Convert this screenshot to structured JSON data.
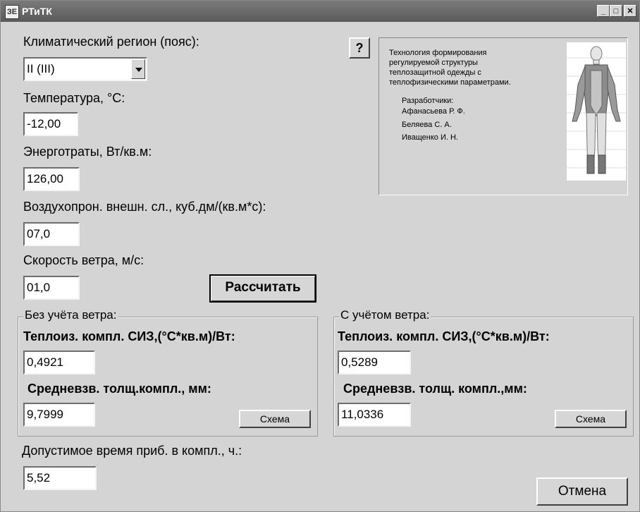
{
  "window": {
    "title": "РТиТК",
    "icon_text": "ЗЕ"
  },
  "titlebar_buttons": {
    "minimize": "_",
    "maximize": "□",
    "close": "✕"
  },
  "form": {
    "region_label": "Климатический регион (пояс):",
    "region_value": "II (III)",
    "help_label": "?",
    "temp_label": "Температура, °С:",
    "temp_value": "-12,00",
    "energy_label": "Энерготраты, Вт/кв.м:",
    "energy_value": "126,00",
    "air_label": "Воздухопрон. внешн. сл., куб.дм/(кв.м*с):",
    "air_value": "07,0",
    "wind_label": "Скорость ветра, м/с:",
    "wind_value": "01,0",
    "calc_button": "Рассчитать"
  },
  "info": {
    "line1": "Технология формирования",
    "line2": "регулируемой структуры",
    "line3": "теплозащитной одежды с",
    "line4": "теплофизическими параметрами.",
    "dev_title": "Разработчики:",
    "dev1": "Афанасьева Р. Ф.",
    "dev2": "Беляева С. А.",
    "dev3": "Иващенко И. Н."
  },
  "no_wind": {
    "legend": "Без учёта ветра:",
    "insul_label": "Теплоиз. компл. СИЗ,(°С*кв.м)/Вт:",
    "insul_value": "0,4921",
    "thick_label": "Средневзв. толщ.компл., мм:",
    "thick_value": "9,7999",
    "scheme_button": "Схема"
  },
  "with_wind": {
    "legend": "С учётом ветра:",
    "insul_label": "Теплоиз. компл. СИЗ,(°С*кв.м)/Вт:",
    "insul_value": "0,5289",
    "thick_label": "Средневзв. толщ. компл.,мм:",
    "thick_value": "11,0336",
    "scheme_button": "Схема"
  },
  "footer": {
    "time_label": "Допустимое время приб. в компл., ч.:",
    "time_value": "5,52",
    "cancel_button": "Отмена"
  }
}
